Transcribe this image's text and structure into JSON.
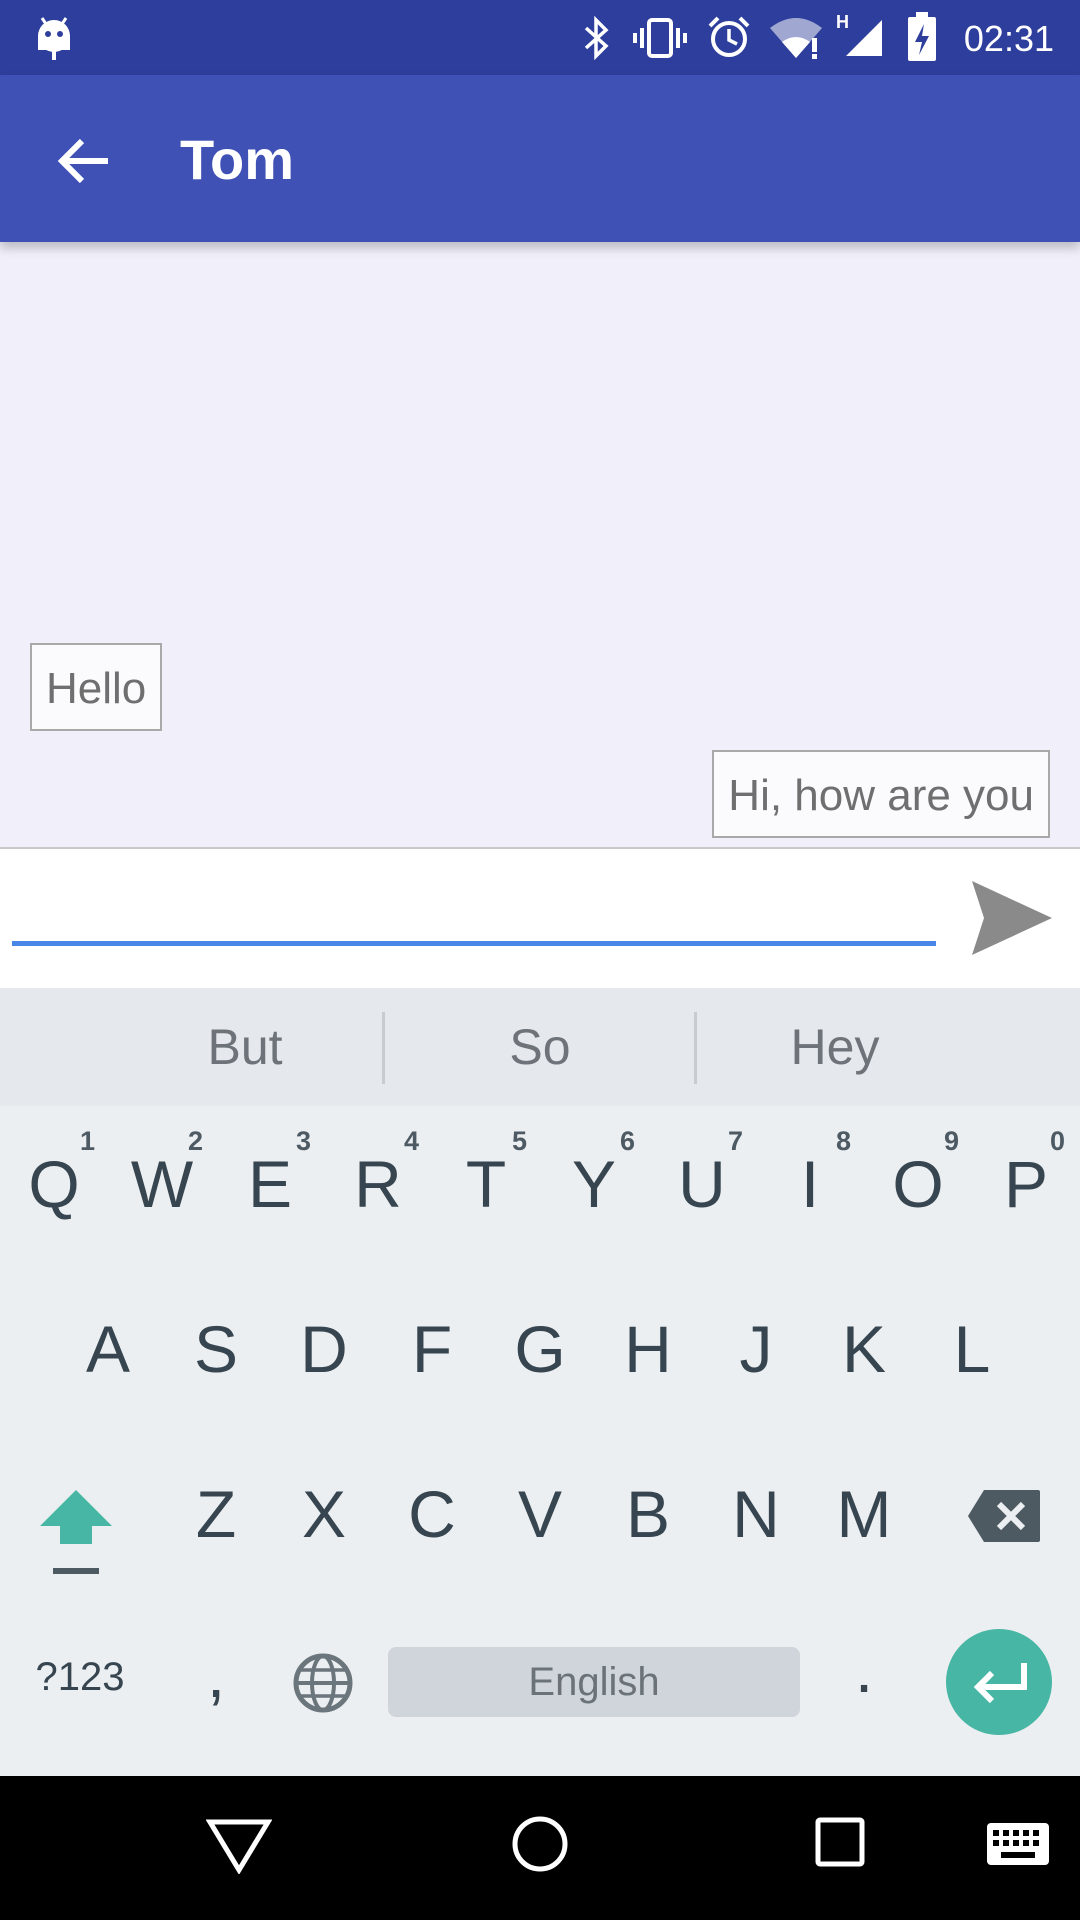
{
  "status_bar": {
    "time": "02:31"
  },
  "app_bar": {
    "title": "Tom"
  },
  "messages": [
    {
      "text": "Hello"
    },
    {
      "text": "Hi, how are you"
    }
  ],
  "composer": {
    "placeholder": ""
  },
  "suggestions": [
    "But",
    "So",
    "Hey"
  ],
  "keyboard": {
    "row1": [
      "Q",
      "W",
      "E",
      "R",
      "T",
      "Y",
      "U",
      "I",
      "O",
      "P"
    ],
    "row1_hints": [
      "1",
      "2",
      "3",
      "4",
      "5",
      "6",
      "7",
      "8",
      "9",
      "0"
    ],
    "row2": [
      "A",
      "S",
      "D",
      "F",
      "G",
      "H",
      "J",
      "K",
      "L"
    ],
    "row3": [
      "Z",
      "X",
      "C",
      "V",
      "B",
      "N",
      "M"
    ],
    "symbols_label": "?123",
    "comma_label": ",",
    "period_label": ".",
    "space_label": "English"
  },
  "colors": {
    "status_bar": "#2e3e9c",
    "app_bar": "#3f51b5",
    "accent_teal": "#47b6a5",
    "input_underline": "#4a86e8"
  }
}
